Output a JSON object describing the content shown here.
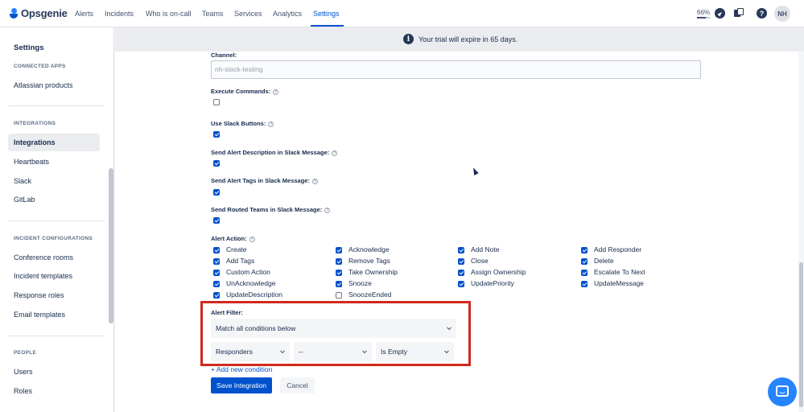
{
  "app": {
    "name": "Opsgenie"
  },
  "nav": {
    "items": [
      {
        "label": "Alerts"
      },
      {
        "label": "Incidents"
      },
      {
        "label": "Who is on-call"
      },
      {
        "label": "Teams"
      },
      {
        "label": "Services"
      },
      {
        "label": "Analytics"
      },
      {
        "label": "Settings"
      }
    ],
    "active": "Settings",
    "zoom_label": "66%",
    "zoom_level": 0.66,
    "avatar_initials": "NH",
    "icons": [
      "compass-icon",
      "apps-icon",
      "help-icon"
    ]
  },
  "banner": {
    "text": "Your trial will expire in 65 days.",
    "icon": "info-icon"
  },
  "sidebar": {
    "title": "Settings",
    "sections": [
      {
        "title": "CONNECTED APPS",
        "items": [
          {
            "label": "Atlassian products"
          }
        ]
      },
      {
        "title": "INTEGRATIONS",
        "items": [
          {
            "label": "Integrations"
          },
          {
            "label": "Heartbeats"
          },
          {
            "label": "Slack"
          },
          {
            "label": "GitLab"
          }
        ]
      },
      {
        "title": "INCIDENT CONFIGURATIONS",
        "items": [
          {
            "label": "Conference rooms"
          },
          {
            "label": "Incident templates"
          },
          {
            "label": "Response roles"
          },
          {
            "label": "Email templates"
          }
        ]
      },
      {
        "title": "PEOPLE",
        "items": [
          {
            "label": "Users"
          },
          {
            "label": "Roles"
          }
        ]
      }
    ],
    "active_item": "Integrations"
  },
  "form": {
    "channel": {
      "label": "Channel:",
      "placeholder": "nh-slack-testing"
    },
    "execute_commands": {
      "label": "Execute Commands:",
      "checked": false
    },
    "use_slack_buttons": {
      "label": "Use Slack Buttons:",
      "checked": true
    },
    "send_description": {
      "label": "Send Alert Description in Slack Message:",
      "checked": true
    },
    "send_tags": {
      "label": "Send Alert Tags in Slack Message:",
      "checked": true
    },
    "send_routed_teams": {
      "label": "Send Routed Teams in Slack Message:",
      "checked": true
    },
    "alert_action": {
      "label": "Alert Action:",
      "actions": [
        {
          "label": "Create",
          "checked": true
        },
        {
          "label": "Acknowledge",
          "checked": true
        },
        {
          "label": "Add Note",
          "checked": true
        },
        {
          "label": "Add Responder",
          "checked": true
        },
        {
          "label": "Add Tags",
          "checked": true
        },
        {
          "label": "Remove Tags",
          "checked": true
        },
        {
          "label": "Close",
          "checked": true
        },
        {
          "label": "Delete",
          "checked": true
        },
        {
          "label": "Custom Action",
          "checked": true
        },
        {
          "label": "Take Ownership",
          "checked": true
        },
        {
          "label": "Assign Ownership",
          "checked": true
        },
        {
          "label": "Escalate To Next",
          "checked": true
        },
        {
          "label": "UnAcknowledge",
          "checked": true
        },
        {
          "label": "Snooze",
          "checked": true
        },
        {
          "label": "UpdatePriority",
          "checked": true
        },
        {
          "label": "UpdateMessage",
          "checked": true
        },
        {
          "label": "UpdateDescription",
          "checked": true
        },
        {
          "label": "SnoozeEnded",
          "checked": false
        }
      ]
    },
    "alert_filter": {
      "label": "Alert Filter:",
      "match": "Match all conditions below",
      "condition": {
        "field": "Responders",
        "operator": "--",
        "value": "Is Empty"
      },
      "add_condition": "+ Add new condition"
    },
    "save_label": "Save Integration",
    "cancel_label": "Cancel"
  },
  "colors": {
    "primary": "#0052cc",
    "highlight": "#d0291d",
    "chat": "#2684ff"
  }
}
